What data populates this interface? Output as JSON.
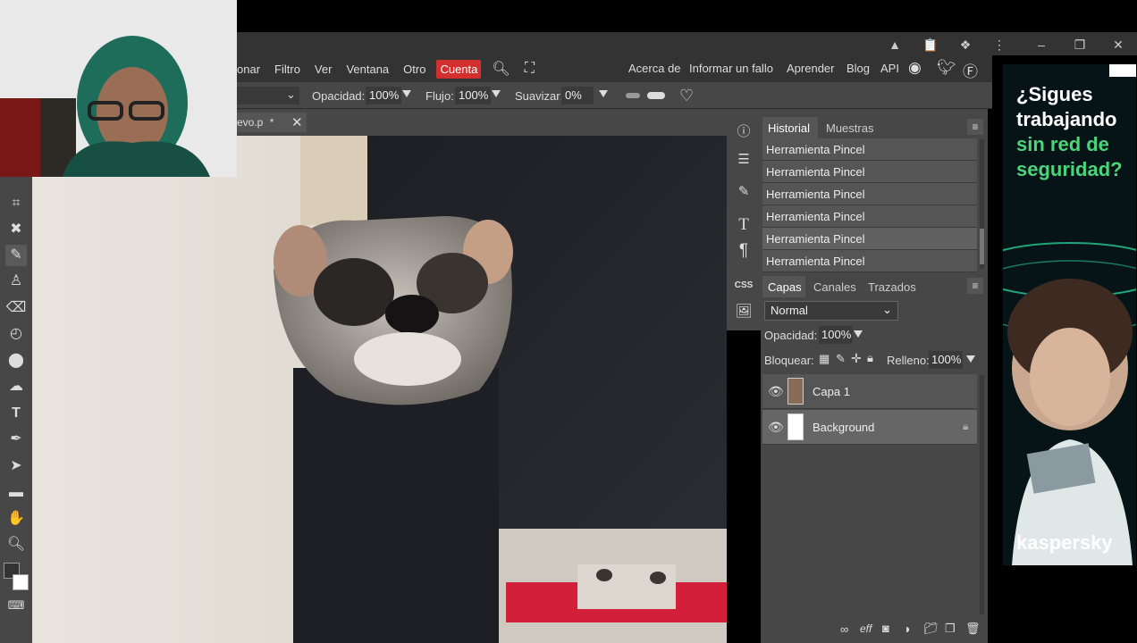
{
  "menu": {
    "items": [
      "onar",
      "Filtro",
      "Ver",
      "Ventana",
      "Otro"
    ],
    "active": "Cuenta",
    "right": [
      "Acerca de",
      "Informar un fallo",
      "Aprender",
      "Blog",
      "API"
    ]
  },
  "options": {
    "opacity_label": "Opacidad:",
    "opacity_value": "100%",
    "flow_label": "Flujo:",
    "flow_value": "100%",
    "smooth_label": "Suavizar:",
    "smooth_value": "0%"
  },
  "document": {
    "tab_title": "evo.p",
    "modified": "*"
  },
  "history": {
    "tabs": [
      "Historial",
      "Muestras"
    ],
    "items": [
      "Herramienta Pincel",
      "Herramienta Pincel",
      "Herramienta Pincel",
      "Herramienta Pincel",
      "Herramienta Pincel",
      "Herramienta Pincel"
    ]
  },
  "layers": {
    "tabs": [
      "Capas",
      "Canales",
      "Trazados"
    ],
    "blend_mode": "Normal",
    "opacity_label": "Opacidad:",
    "opacity_value": "100%",
    "lock_label": "Bloquear:",
    "fill_label": "Relleno:",
    "fill_value": "100%",
    "items": [
      {
        "name": "Capa 1",
        "locked": false
      },
      {
        "name": "Background",
        "locked": true
      }
    ]
  },
  "dock": {
    "css_label": "CSS",
    "type_label": "T"
  },
  "ad": {
    "line1": "¿Sigues trabajando",
    "line2": "sin red de",
    "line3": "seguridad?",
    "brand": "kaspersky"
  },
  "colors": {
    "accent": "#d32f2f",
    "panel": "#474747",
    "menubar": "#333333",
    "ad_green": "#4cd47a"
  }
}
